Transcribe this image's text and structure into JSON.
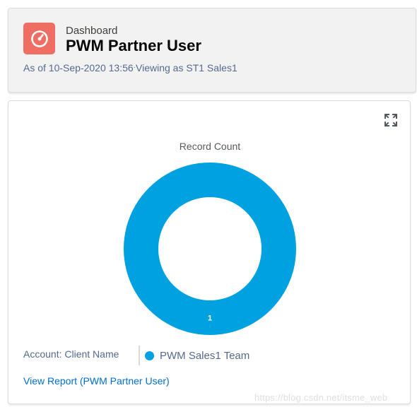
{
  "header": {
    "object_label": "Dashboard",
    "title": "PWM Partner User",
    "as_of": "As of 10-Sep-2020 13:56",
    "separator": "·",
    "viewing_as": "Viewing as ST1 Sales1",
    "icon": "dashboard-gauge-icon",
    "icon_color": "#ef6e64"
  },
  "widget": {
    "expand_icon": "expand-icon",
    "legend_title": "Account: Client Name",
    "view_report_label": "View Report (PWM Partner User)"
  },
  "chart_data": {
    "type": "pie",
    "subtype": "donut",
    "title": "Record Count",
    "labels": [
      "PWM Sales1 Team"
    ],
    "values": [
      1
    ],
    "colors": [
      "#00a1e0"
    ],
    "legend_position": "bottom-left"
  },
  "watermark": "https://blog.csdn.net/itsme_web"
}
